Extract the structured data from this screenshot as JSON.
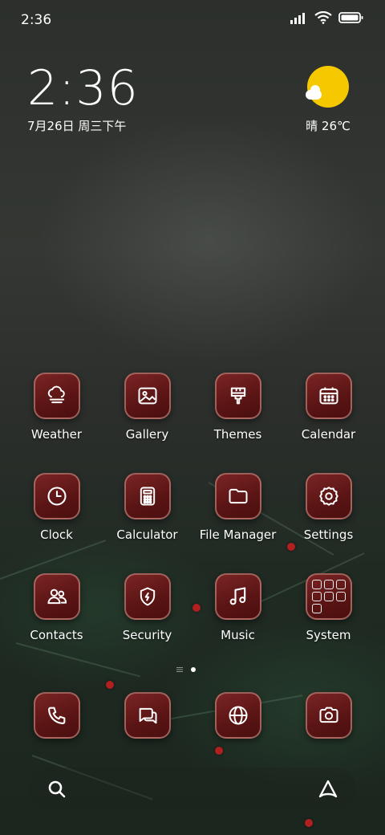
{
  "status_bar": {
    "time": "2:36",
    "icons": [
      "signal-icon",
      "wifi-icon",
      "battery-icon"
    ]
  },
  "clock_widget": {
    "time": "2:36",
    "date": "7月26日 周三下午"
  },
  "weather_widget": {
    "condition_icon": "sun-cloud-icon",
    "text": "晴 26℃"
  },
  "apps": [
    {
      "label": "Weather",
      "icon": "weather-icon"
    },
    {
      "label": "Gallery",
      "icon": "gallery-icon"
    },
    {
      "label": "Themes",
      "icon": "brush-icon"
    },
    {
      "label": "Calendar",
      "icon": "calendar-icon"
    },
    {
      "label": "Clock",
      "icon": "clock-icon"
    },
    {
      "label": "Calculator",
      "icon": "calculator-icon"
    },
    {
      "label": "File Manager",
      "icon": "folder-icon"
    },
    {
      "label": "Settings",
      "icon": "gear-icon"
    },
    {
      "label": "Contacts",
      "icon": "contacts-icon"
    },
    {
      "label": "Security",
      "icon": "shield-icon"
    },
    {
      "label": "Music",
      "icon": "music-note-icon"
    },
    {
      "label": "System",
      "icon": "folder-grid-icon"
    }
  ],
  "page_indicator": {
    "pages": 1,
    "active": 1
  },
  "dock": [
    {
      "icon": "phone-icon"
    },
    {
      "icon": "messages-icon"
    },
    {
      "icon": "browser-icon"
    },
    {
      "icon": "camera-icon"
    }
  ],
  "search_bar": {
    "left_icon": "search-icon",
    "right_icon": "assistant-icon"
  },
  "colors": {
    "tile": "#6a1a1a",
    "tile_border": "#dca096",
    "sun": "#f5c800"
  }
}
